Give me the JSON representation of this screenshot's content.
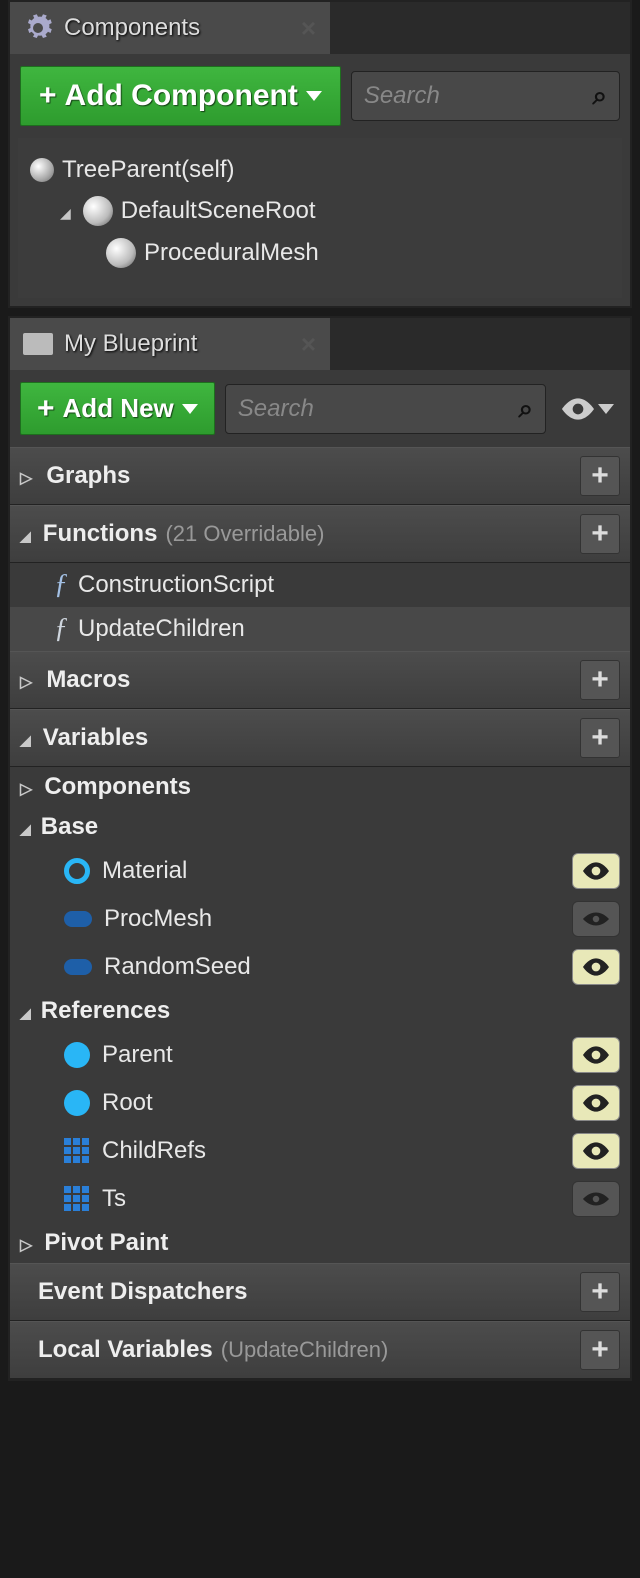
{
  "components_panel": {
    "title": "Components",
    "add_button": "Add Component",
    "search_placeholder": "Search",
    "tree": [
      {
        "label": "TreeParent(self)",
        "indent": 0,
        "icon": "sphere-small"
      },
      {
        "label": "DefaultSceneRoot",
        "indent": 1,
        "icon": "sphere-lg",
        "expanded": true
      },
      {
        "label": "ProceduralMesh",
        "indent": 2,
        "icon": "sphere-lg"
      }
    ]
  },
  "blueprint_panel": {
    "title": "My Blueprint",
    "add_button": "Add New",
    "search_placeholder": "Search",
    "sections": {
      "graphs": {
        "label": "Graphs",
        "expanded": false
      },
      "functions": {
        "label": "Functions",
        "meta": "(21 Overridable)",
        "expanded": true,
        "items": [
          {
            "label": "ConstructionScript",
            "icon": "fx"
          },
          {
            "label": "UpdateChildren",
            "icon": "fx",
            "selected": true
          }
        ]
      },
      "macros": {
        "label": "Macros",
        "expanded": false
      },
      "variables": {
        "label": "Variables",
        "expanded": true,
        "groups": [
          {
            "label": "Components",
            "expanded": false
          },
          {
            "label": "Base",
            "expanded": true,
            "vars": [
              {
                "name": "Material",
                "icon": "circle-outline",
                "visible": true
              },
              {
                "name": "ProcMesh",
                "icon": "pill",
                "visible": false
              },
              {
                "name": "RandomSeed",
                "icon": "pill",
                "visible": true
              }
            ]
          },
          {
            "label": "References",
            "expanded": true,
            "vars": [
              {
                "name": "Parent",
                "icon": "circle-filled",
                "visible": true
              },
              {
                "name": "Root",
                "icon": "circle-filled",
                "visible": true
              },
              {
                "name": "ChildRefs",
                "icon": "grid",
                "visible": true
              },
              {
                "name": "Ts",
                "icon": "grid",
                "visible": false
              }
            ]
          },
          {
            "label": "Pivot Paint",
            "expanded": false
          }
        ]
      },
      "dispatchers": {
        "label": "Event Dispatchers"
      },
      "locals": {
        "label": "Local Variables",
        "meta": "(UpdateChildren)"
      }
    }
  }
}
